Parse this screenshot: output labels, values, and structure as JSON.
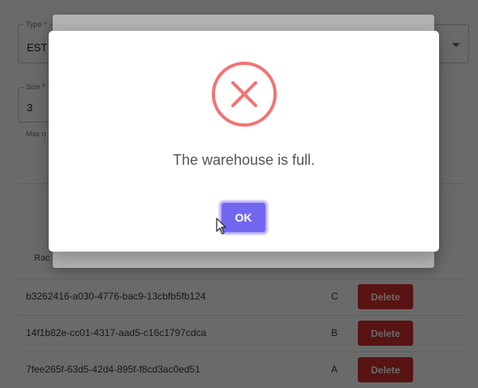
{
  "form": {
    "type_label": "Type *",
    "type_value": "EST",
    "size_label": "Size *",
    "size_value": "3",
    "helper_text": "Max n"
  },
  "table": {
    "header_rack": "Rac",
    "rows": [
      {
        "id": "b3262416-a030-4776-bac9-13cbfb5fb124",
        "letter": "C",
        "action": "Delete"
      },
      {
        "id": "14f1b82e-cc01-4317-aad5-c16c1797cdca",
        "letter": "B",
        "action": "Delete"
      },
      {
        "id": "7fee265f-63d5-42d4-895f-f8cd3ac0ed51",
        "letter": "A",
        "action": "Delete"
      }
    ]
  },
  "alert": {
    "icon": "error-x-icon",
    "message": "The warehouse is full.",
    "ok_label": "OK"
  },
  "colors": {
    "error_icon": "#f27474",
    "ok_button": "#7367f0",
    "delete_button": "#d32f2f"
  }
}
